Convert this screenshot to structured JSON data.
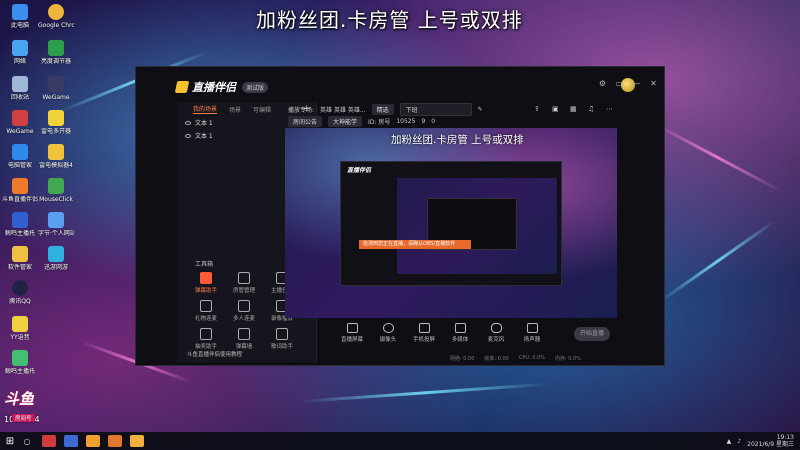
{
  "headline": "加粉丝团.卡房管 上号或双排",
  "desktop_icons": [
    {
      "label": "此电脑",
      "color": "#3b8ef0"
    },
    {
      "label": "Google Chrome",
      "color": "#f0b53b"
    },
    {
      "label": "网络",
      "color": "#4aa3f0"
    },
    {
      "label": "亮度调节器",
      "color": "#2e9e4e"
    },
    {
      "label": "回收站",
      "color": "#9fb8d8"
    },
    {
      "label": "WeGame",
      "color": "#3a3a66"
    },
    {
      "label": "WeGame",
      "color": "#d04040"
    },
    {
      "label": "雷电多开器",
      "color": "#f0d23b"
    },
    {
      "label": "电脑管家",
      "color": "#2f8af0"
    },
    {
      "label": "雷电模拟器4",
      "color": "#f0c23b"
    },
    {
      "label": "斗鱼直播伴侣",
      "color": "#f07a2a"
    },
    {
      "label": "MouseClick",
      "color": "#40a850"
    },
    {
      "label": "鲸鸣主播托",
      "color": "#3060d0"
    },
    {
      "label": "字节·个人网站",
      "color": "#5aa0f0"
    },
    {
      "label": "软件管家",
      "color": "#f0c040"
    },
    {
      "label": "迅游网游",
      "color": "#30b0e0"
    },
    {
      "label": "腾讯QQ",
      "color": "#222244"
    },
    {
      "label": "YY语音",
      "color": "#f0d040"
    },
    {
      "label": "鲸鸣主播托",
      "color": "#40c070"
    },
    {
      "label": "",
      "color": "#c04070"
    }
  ],
  "app": {
    "logo": "直播伴侣",
    "version_badge": "测试版",
    "title_buttons": [
      "⚙",
      "▭",
      "—",
      "✕"
    ],
    "sidebar_tabs": [
      "我的场景",
      "场景",
      "可编辑"
    ],
    "scenes": [
      "文本 1",
      "文本 1"
    ],
    "tools_title": "工具箱",
    "tools": [
      {
        "label": "弹幕助手",
        "hot": true
      },
      {
        "label": "房管管理",
        "hot": false
      },
      {
        "label": "主播任务",
        "hot": false
      },
      {
        "label": "礼物连麦",
        "hot": false
      },
      {
        "label": "多人连麦",
        "hot": false
      },
      {
        "label": "录像播放",
        "hot": false
      },
      {
        "label": "抽奖助手",
        "hot": false
      },
      {
        "label": "弹幕墙",
        "hot": false
      },
      {
        "label": "歌词助手",
        "hot": false
      }
    ],
    "footer": "斗鱼直播伴侣使用教程",
    "topbar": {
      "category_label": "播放专场:",
      "category_value": "英雄 英雄 英雄...",
      "tag": "精选",
      "live_title": "下班",
      "announce_pill": "房间公告",
      "edit_pill": "大神能学",
      "room_id": "10525",
      "room_label": "ID: 房号",
      "viewers": "9",
      "score": "0"
    },
    "preview_caption": "加粉丝团.卡房管 上号或双排",
    "inner": {
      "logo": "直播伴侣",
      "tip": "检测到您正在直播，请确认OBS/直播软件"
    },
    "controls": [
      "直播屏幕",
      "摄像头",
      "手机投屏",
      "多媒体",
      "麦克风",
      "扬声器"
    ],
    "go_live": "开始直播",
    "status": [
      "网络: 0.00",
      "帧率: 0.00",
      "CPU: 0.0%",
      "内存: 0.0%",
      "GPU: 0.0%"
    ]
  },
  "room_badge": {
    "logo": "斗鱼",
    "sub": "房间号",
    "number": "1052254"
  },
  "taskbar": {
    "apps": [
      "#d03c3c",
      "#3c6ad0",
      "#f0a030",
      "#e07830",
      "#f0b040"
    ],
    "time": "19:13",
    "date": "2021/6/9 星期三"
  }
}
